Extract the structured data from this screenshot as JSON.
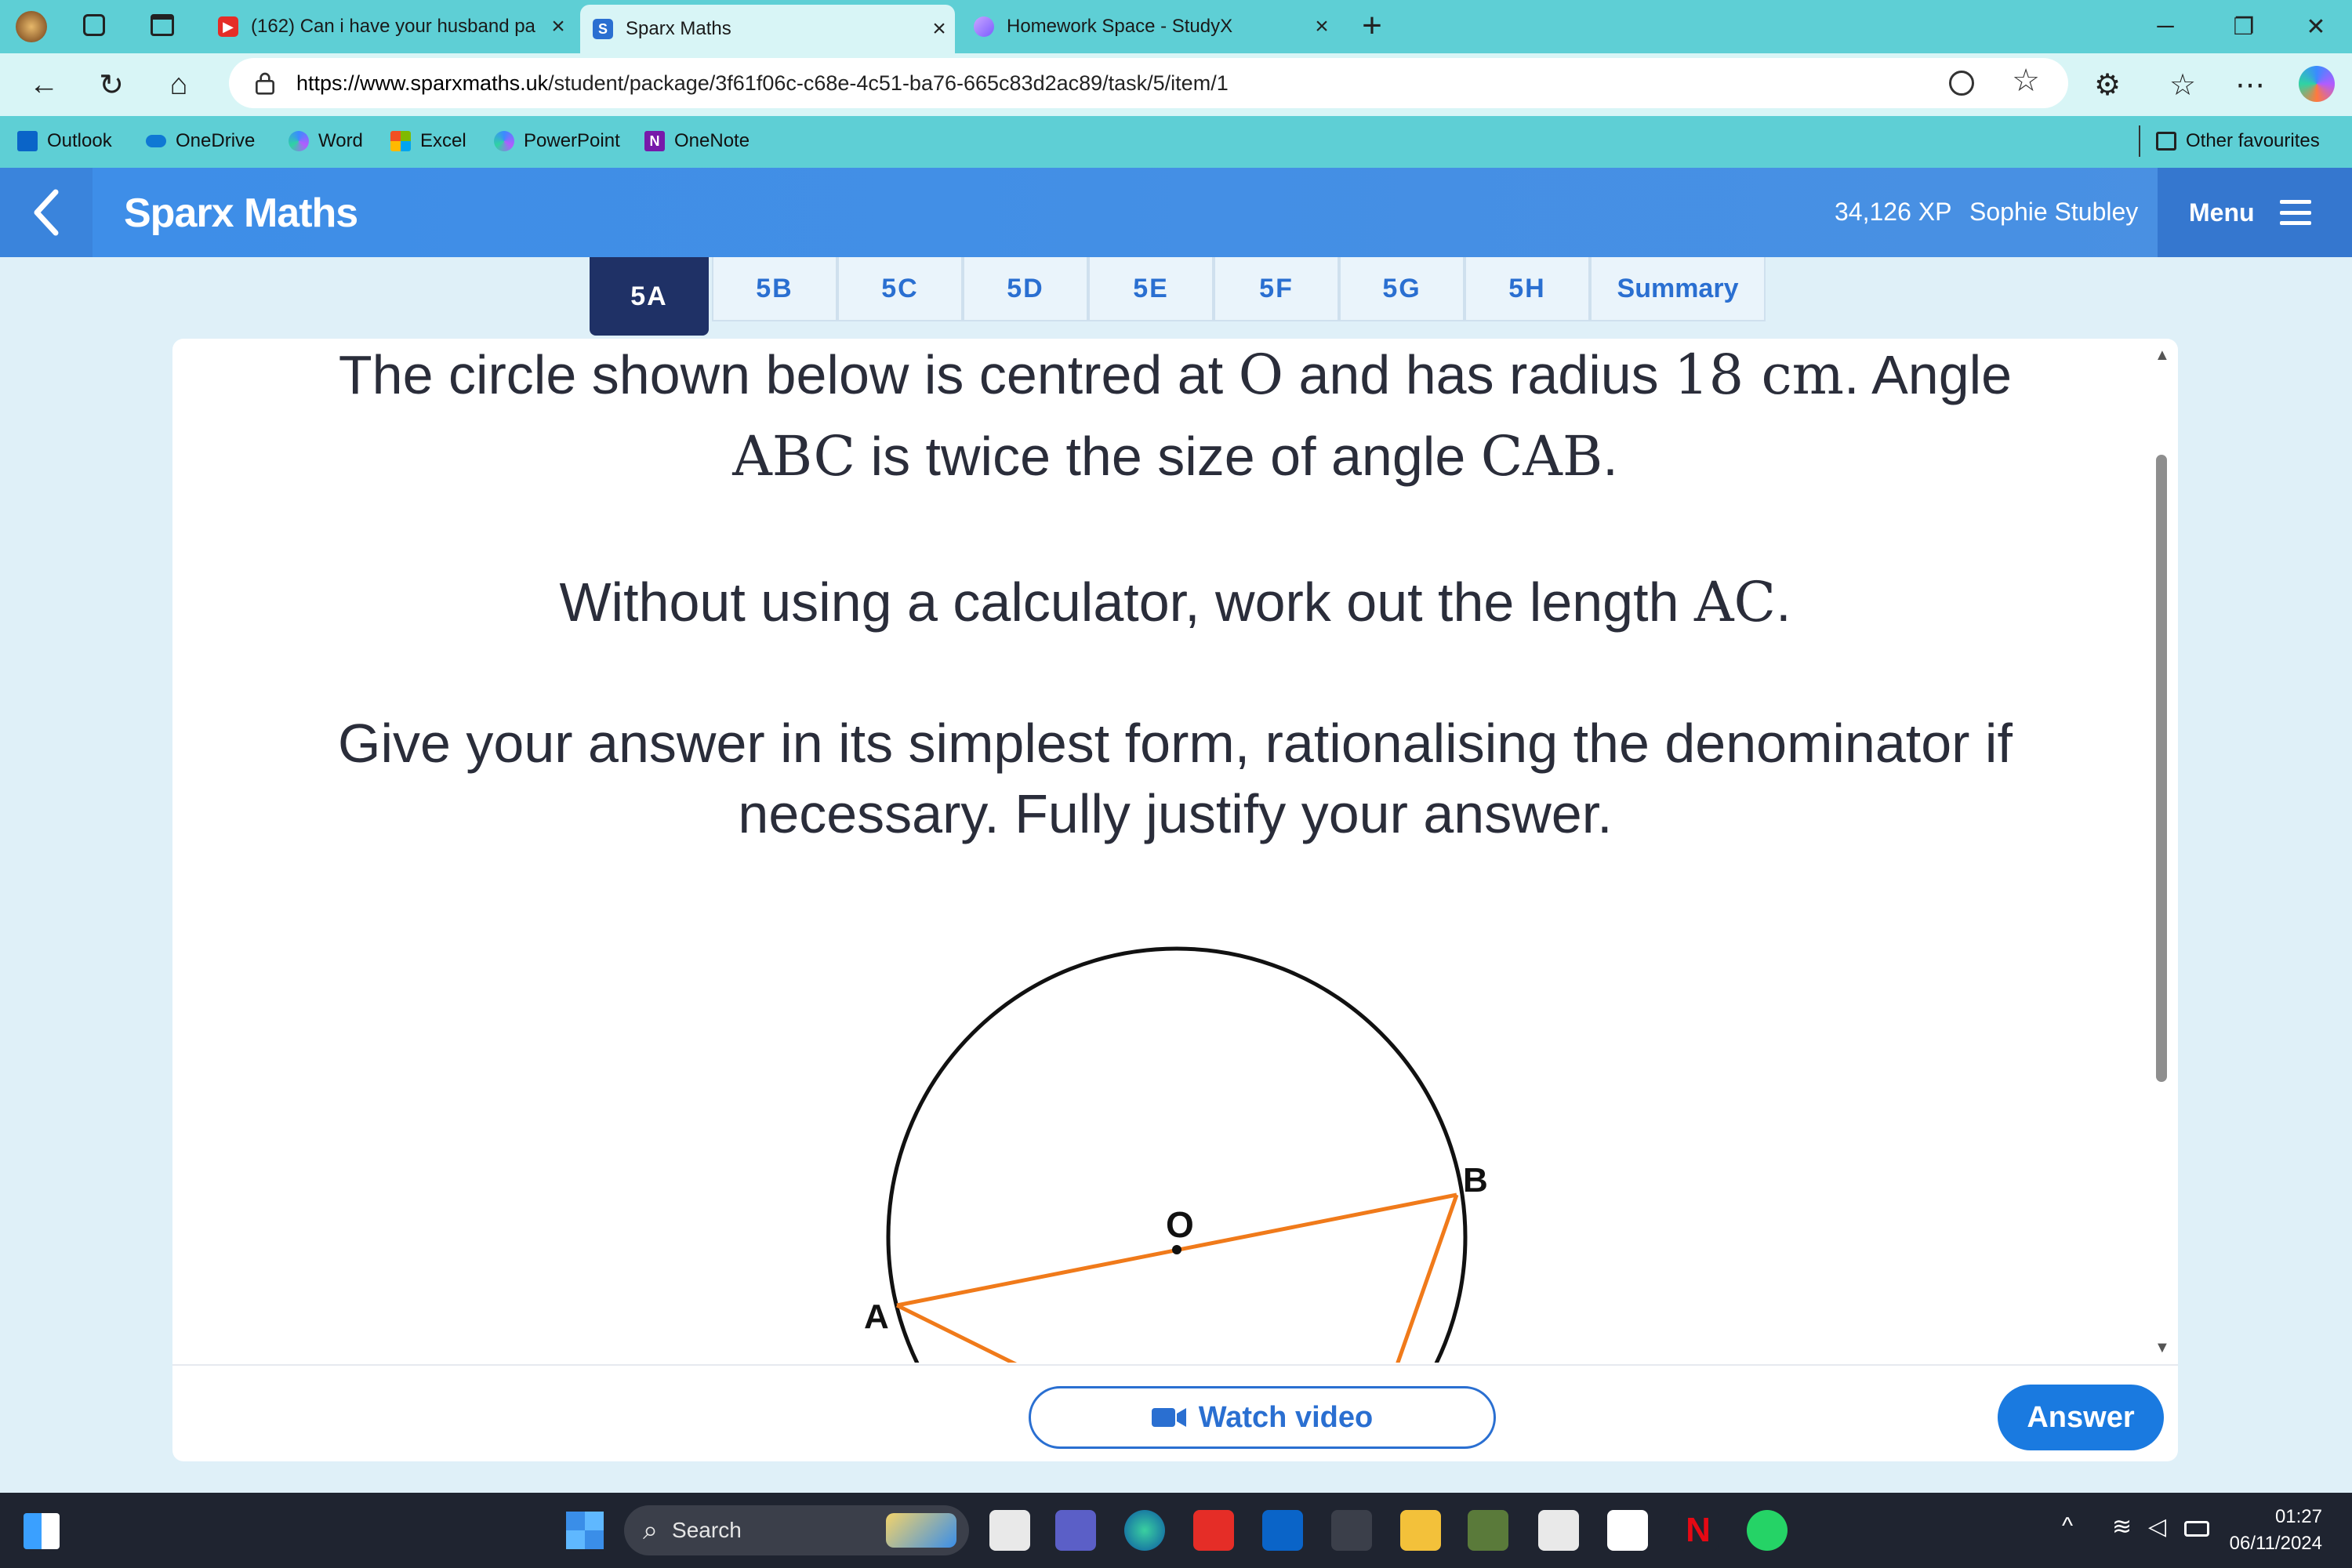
{
  "browser": {
    "tabs": [
      {
        "title": "(162) Can i have your husband pa",
        "icon": "youtube-icon"
      },
      {
        "title": "Sparx Maths",
        "icon": "sparx-icon",
        "icon_text": "S"
      },
      {
        "title": "Homework Space - StudyX",
        "icon": "studyx-icon"
      }
    ],
    "new_tab_glyph": "+",
    "url_host": "https://www.sparxmaths.uk",
    "url_path": "/student/package/3f61f06c-c68e-4c51-ba76-665c83d2ac89/task/5/item/1",
    "favourites": [
      {
        "label": "Outlook",
        "color": "#0a64c8"
      },
      {
        "label": "OneDrive",
        "color": "#0f78d4"
      },
      {
        "label": "Word",
        "color": "#7a5cf0"
      },
      {
        "label": "Excel",
        "color": "#f25022"
      },
      {
        "label": "PowerPoint",
        "color": "#7a5cf0"
      },
      {
        "label": "OneNote",
        "color": "#7719aa"
      }
    ],
    "other_favourites": "Other favourites"
  },
  "sparx": {
    "title": "Sparx Maths",
    "xp": "34,126 XP",
    "user": "Sophie Stubley",
    "menu_label": "Menu",
    "tabs": [
      "5A",
      "5B",
      "5C",
      "5D",
      "5E",
      "5F",
      "5G",
      "5H",
      "Summary"
    ],
    "active_tab": "5A"
  },
  "question": {
    "line1_pre": "The circle shown below is centred at ",
    "line1_O": "O",
    "line1_mid": " and has radius ",
    "line1_radius": "18 cm",
    "line1_post": ". Angle",
    "line2_ABC": "ABC",
    "line2_mid": " is twice the size of angle ",
    "line2_CAB": "CAB",
    "line2_post": ".",
    "line3_pre": "Without using a calculator, work out the length ",
    "line3_AC": "AC",
    "line3_post": ".",
    "line4": "Give your answer in its simplest form, rationalising the denominator if",
    "line5": "necessary. Fully justify your answer."
  },
  "diagram": {
    "label_O": "O",
    "label_A": "A",
    "label_B": "B",
    "line_color": "#f07a1a"
  },
  "actions": {
    "watch_video": "Watch video",
    "answer": "Answer"
  },
  "taskbar": {
    "search": "Search",
    "time": "01:27",
    "date": "06/11/2024"
  }
}
